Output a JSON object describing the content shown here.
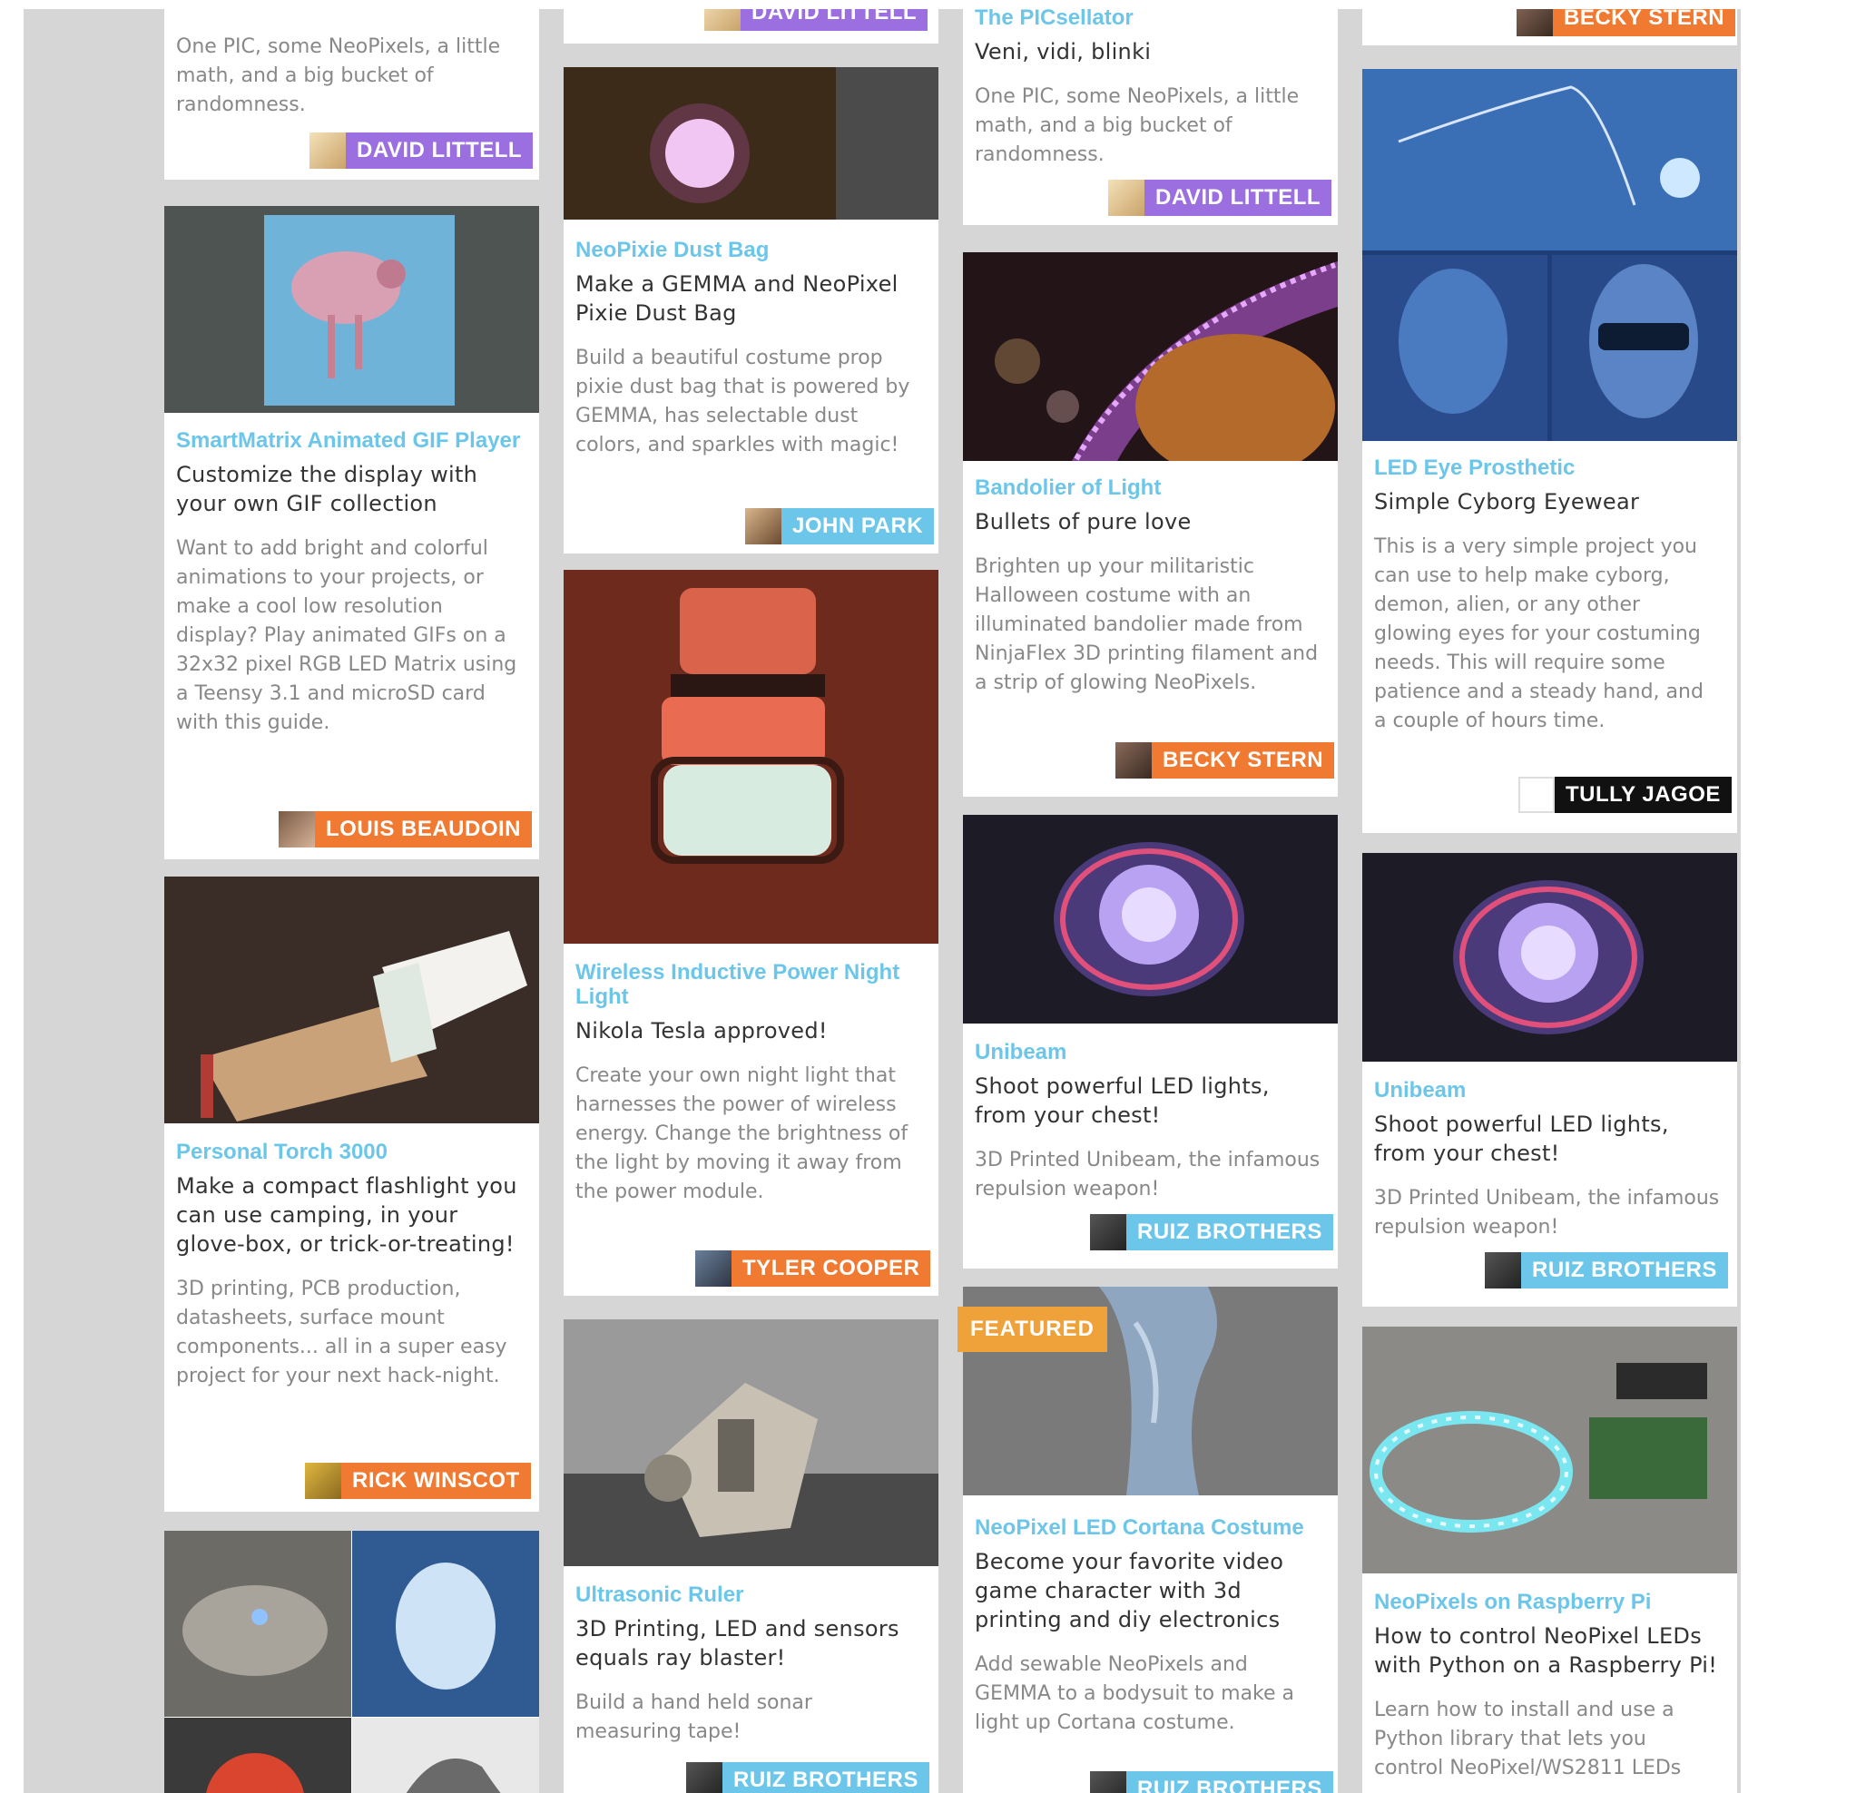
{
  "colors": {
    "purple": "#9b6fe0",
    "orange": "#f07a32",
    "blue": "#6cc6ea",
    "black": "#111111",
    "featured": "#f0a23a"
  },
  "cards": {
    "c1_top": {
      "desc": "One PIC, some NeoPixels, a little math, and a big bucket of randomness.",
      "author": "DAVID LITTELL"
    },
    "c1_smartmatrix": {
      "title": "SmartMatrix Animated GIF Player",
      "subtitle": "Customize the display with your own GIF collection",
      "desc": "Want to add bright and colorful animations to your projects, or make a cool low resolution display? Play animated GIFs on a 32x32 pixel RGB LED Matrix using a Teensy 3.1 and microSD card with this guide.",
      "author": "LOUIS BEAUDOIN"
    },
    "c1_torch": {
      "title": "Personal Torch 3000",
      "subtitle": "Make a compact flashlight you can use camping, in your glove-box, or trick-or-treating!",
      "desc": "3D printing, PCB production, datasheets, surface mount components... all in a super easy project for your next hack-night.",
      "author": "RICK WINSCOT"
    },
    "c2_top": {
      "author": "DAVID LITTELL"
    },
    "c2_dustbag": {
      "title": "NeoPixie Dust Bag",
      "subtitle": "Make a GEMMA and NeoPixel Pixie Dust Bag",
      "desc": "Build a beautiful costume prop pixie dust bag that is powered by GEMMA, has selectable dust colors, and sparkles with magic!",
      "author": "JOHN PARK"
    },
    "c2_wireless": {
      "title": "Wireless Inductive Power Night Light",
      "subtitle": "Nikola Tesla approved!",
      "desc": "Create your own night light that harnesses the power of wireless energy. Change the brightness of the light by moving it away from the power module.",
      "author": "TYLER COOPER"
    },
    "c2_ruler": {
      "title": "Ultrasonic Ruler",
      "subtitle": "3D Printing, LED and sensors equals ray blaster!",
      "desc": "Build a hand held sonar measuring tape!",
      "author": "RUIZ BROTHERS"
    },
    "c3_top": {
      "title": "The PICsellator",
      "subtitle": "Veni, vidi, blinki",
      "desc": "One PIC, some NeoPixels, a little math, and a big bucket of randomness.",
      "author": "DAVID LITTELL"
    },
    "c3_bandolier": {
      "title": "Bandolier of Light",
      "subtitle": "Bullets of pure love",
      "desc": "Brighten up your militaristic Halloween costume with an illuminated bandolier made from NinjaFlex 3D printing filament and a strip of glowing NeoPixels.",
      "author": "BECKY STERN"
    },
    "c3_unibeam": {
      "title": "Unibeam",
      "subtitle": "Shoot powerful LED lights, from your chest!",
      "desc": "3D Printed Unibeam, the infamous repulsion weapon!",
      "author": "RUIZ BROTHERS"
    },
    "c3_cortana": {
      "badge": "FEATURED",
      "title": "NeoPixel LED Cortana Costume",
      "subtitle": "Become your favorite video game character with 3d printing and diy electronics",
      "desc": "Add sewable NeoPixels and GEMMA to a bodysuit to make a light up Cortana costume.",
      "author": "RUIZ BROTHERS"
    },
    "c4_top": {
      "author": "BECKY STERN"
    },
    "c4_eye": {
      "title": "LED Eye Prosthetic",
      "subtitle": "Simple Cyborg Eyewear",
      "desc": "This is a very simple project you can use to help make cyborg, demon, alien, or any other glowing eyes for your costuming needs. This will require some patience and a steady hand, and a couple of hours time.",
      "author": "TULLY JAGOE"
    },
    "c4_unibeam": {
      "title": "Unibeam",
      "subtitle": "Shoot powerful LED lights, from your chest!",
      "desc": "3D Printed Unibeam, the infamous repulsion weapon!",
      "author": "RUIZ BROTHERS"
    },
    "c4_raspi": {
      "title": "NeoPixels on Raspberry Pi",
      "subtitle": "How to control NeoPixel LEDs with Python on a Raspberry Pi!",
      "desc": "Learn how to install and use a Python library that lets you control NeoPixel/WS2811 LEDs"
    }
  }
}
